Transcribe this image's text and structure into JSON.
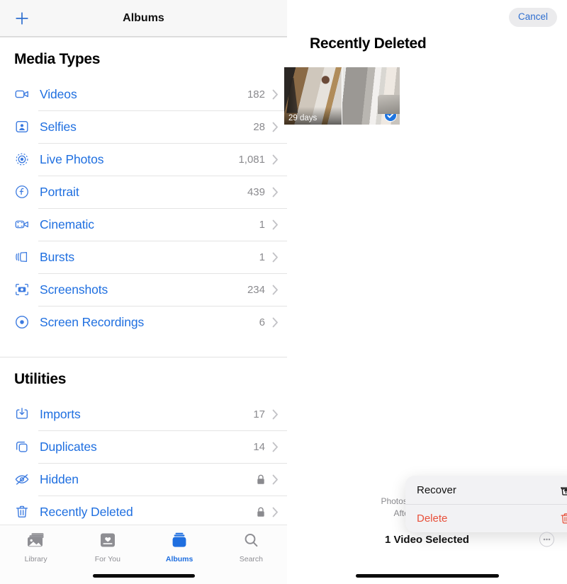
{
  "left": {
    "nav": {
      "title": "Albums",
      "add_icon": "plus-icon"
    },
    "sections": [
      {
        "title": "Media Types",
        "rows": [
          {
            "icon": "video-camera-icon",
            "label": "Videos",
            "count": "182",
            "chevron": "chevron-right-icon"
          },
          {
            "icon": "selfie-person-icon",
            "label": "Selfies",
            "count": "28",
            "chevron": "chevron-right-icon"
          },
          {
            "icon": "live-photo-icon",
            "label": "Live Photos",
            "count": "1,081",
            "chevron": "chevron-right-icon"
          },
          {
            "icon": "portrait-aperture-icon",
            "label": "Portrait",
            "count": "439",
            "chevron": "chevron-right-icon"
          },
          {
            "icon": "cinematic-video-icon",
            "label": "Cinematic",
            "count": "1",
            "chevron": "chevron-right-icon"
          },
          {
            "icon": "bursts-stack-icon",
            "label": "Bursts",
            "count": "1",
            "chevron": "chevron-right-icon"
          },
          {
            "icon": "screenshot-camera-icon",
            "label": "Screenshots",
            "count": "234",
            "chevron": "chevron-right-icon"
          },
          {
            "icon": "screen-recording-icon",
            "label": "Screen Recordings",
            "count": "6",
            "chevron": "chevron-right-icon"
          }
        ]
      },
      {
        "title": "Utilities",
        "rows": [
          {
            "icon": "import-download-icon",
            "label": "Imports",
            "count": "17",
            "chevron": "chevron-right-icon"
          },
          {
            "icon": "duplicates-copy-icon",
            "label": "Duplicates",
            "count": "14",
            "chevron": "chevron-right-icon"
          },
          {
            "icon": "hidden-eye-slash-icon",
            "label": "Hidden",
            "count": "",
            "locked": true,
            "lock_icon": "lock-icon",
            "chevron": "chevron-right-icon"
          },
          {
            "icon": "trash-icon",
            "label": "Recently Deleted",
            "count": "",
            "locked": true,
            "lock_icon": "lock-icon",
            "chevron": "chevron-right-icon"
          }
        ]
      }
    ],
    "tabs": [
      {
        "label": "Library",
        "icon": "photos-stack-icon",
        "active": false
      },
      {
        "label": "For You",
        "icon": "for-you-card-icon",
        "active": false
      },
      {
        "label": "Albums",
        "icon": "albums-book-icon",
        "active": true
      },
      {
        "label": "Search",
        "icon": "magnifier-icon",
        "active": false
      }
    ]
  },
  "right": {
    "cancel_label": "Cancel",
    "title": "Recently Deleted",
    "thumbnails": [
      {
        "badge": "29 days",
        "selected": false
      },
      {
        "badge": "",
        "selected": true,
        "check_icon": "checkmark-circle-icon"
      }
    ],
    "footer_line1": "Photos and videos show",
    "footer_line2": "After that time, ite",
    "context_menu": [
      {
        "label": "Recover",
        "icon": "recover-tray-up-icon",
        "destructive": false
      },
      {
        "label": "Delete",
        "icon": "trash-icon",
        "destructive": true
      }
    ],
    "selection_text": "1 Video Selected",
    "more_icon": "ellipsis-circle-icon"
  },
  "colors": {
    "accent_blue": "#1f6fe0",
    "destructive_red": "#e8503a",
    "secondary_gray": "#8a8a8e",
    "chevron_gray": "#c2c2c6",
    "menu_bg": "#f2f2f4"
  }
}
